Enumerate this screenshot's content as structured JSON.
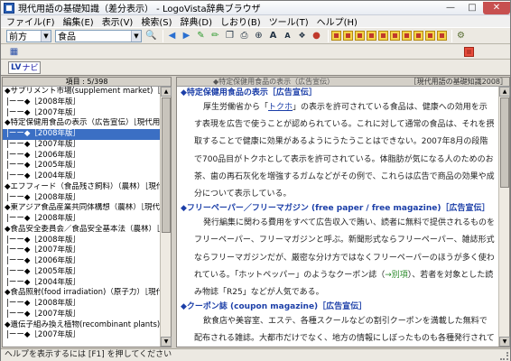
{
  "window": {
    "title": "現代用語の基礎知識（差分表示） - LogoVista辞典ブラウザ"
  },
  "menu": [
    "ファイル(F)",
    "編集(E)",
    "表示(V)",
    "検索(S)",
    "辞典(D)",
    "しおり(B)",
    "ツール(T)",
    "ヘルプ(H)"
  ],
  "toolbar": {
    "search_mode": "前方",
    "search_query": "食品",
    "navi_label": "ナビ"
  },
  "left_pane": {
    "header": "項目 : 5/398",
    "items": [
      {
        "text": "◆サプリメント市場(supplement market)［マーケテ",
        "child": false,
        "selected": false
      },
      {
        "text": "|ーー◆［2008年版］",
        "child": true,
        "selected": false
      },
      {
        "text": "|ーー◆［2007年版］",
        "child": true,
        "selected": false
      },
      {
        "text": "◆特定保健用食品の表示（広告宣伝）［現代用語の基",
        "child": false,
        "selected": false
      },
      {
        "text": "|ーー◆［2008年版］",
        "child": true,
        "selected": true
      },
      {
        "text": "|ーー◆［2007年版］",
        "child": true,
        "selected": false
      },
      {
        "text": "|ーー◆［2006年版］",
        "child": true,
        "selected": false
      },
      {
        "text": "|ーー◆［2005年版］",
        "child": true,
        "selected": false
      },
      {
        "text": "|ーー◆［2004年版］",
        "child": true,
        "selected": false
      },
      {
        "text": "◆エフフィード（食品残さ飼料）（農林）［現代用",
        "child": false,
        "selected": false
      },
      {
        "text": "|ーー◆［2008年版］",
        "child": true,
        "selected": false
      },
      {
        "text": "◆東アジア食品産業共同体構想（農林）［現代用語の",
        "child": false,
        "selected": false
      },
      {
        "text": "|ーー◆［2008年版］",
        "child": true,
        "selected": false
      },
      {
        "text": "◆食品安全委員会／食品安全基本法（農林）［現代",
        "child": false,
        "selected": false
      },
      {
        "text": "|ーー◆［2008年版］",
        "child": true,
        "selected": false
      },
      {
        "text": "|ーー◆［2007年版］",
        "child": true,
        "selected": false
      },
      {
        "text": "|ーー◆［2006年版］",
        "child": true,
        "selected": false
      },
      {
        "text": "|ーー◆［2005年版］",
        "child": true,
        "selected": false
      },
      {
        "text": "|ーー◆［2004年版］",
        "child": true,
        "selected": false
      },
      {
        "text": "◆食品照射(food irradiation)（原子力）［現代用語の",
        "child": false,
        "selected": false
      },
      {
        "text": "|ーー◆［2008年版］",
        "child": true,
        "selected": false
      },
      {
        "text": "|ーー◆［2007年版］",
        "child": true,
        "selected": false
      },
      {
        "text": "◆遺伝子組み換え植物(recombinant plants)［遺伝子",
        "child": false,
        "selected": false
      },
      {
        "text": "|ーー◆［2007年版］",
        "child": true,
        "selected": false
      }
    ]
  },
  "right_pane": {
    "header_left": "◆特定保健用食品の表示（広告宣伝）",
    "header_right": "［現代用語の基礎知識2008］",
    "entries": [
      {
        "title": "◆特定保健用食品の表示［広告宣伝］",
        "paragraphs": [
          {
            "pre": "厚生労働省から「",
            "link": "トクホ",
            "post": "」の表示を許可されている食品は、健康への効用を示す表現を広告で使うことが認められている。これに対して通常の食品は、それを摂取することで健康に効果があるようにうたうことはできない。2007年8月の段階で700品目がトクホとして表示を許可されている。体脂肪が気になる人のためのお茶、歯の再石灰化を増強するガムなどがその例で、これらは広告で商品の効果や成分について表示している。"
          }
        ]
      },
      {
        "title": "◆フリーペーパー／フリーマガジン (free paper / free magazine)［広告宣伝］",
        "paragraphs": [
          {
            "pre": "発行編集に関わる費用をすべて広告収入で賄い、読者に無料で提供されるものをフリーペーパー、フリーマガジンと呼ぶ。新聞形式ならフリーペーパー、雑誌形式ならフリーマガジンだが、厳密な分け方ではなくフリーペーパーのほうが多く使われている。「ホットペッパー」のようなクーポン誌（",
            "green": "→別項",
            "post": "）、若者を対象とした読み物誌「R25」などが人気である。"
          }
        ]
      },
      {
        "title": "◆クーポン誌 (coupon magazine)［広告宣伝］",
        "paragraphs": [
          {
            "pre": "飲食店や美容室、エステ、各種スクールなどの割引クーポンを満載した無料で配布される雑誌。大都市だけでなく、地方の情報にしぼったものも各種発行されている。クーポン誌は、レストランの店頭や商店街の道路上などに設置されたラッ"
          }
        ]
      }
    ]
  },
  "statusbar": {
    "text": "ヘルプを表示するには [F1] を押してください"
  }
}
